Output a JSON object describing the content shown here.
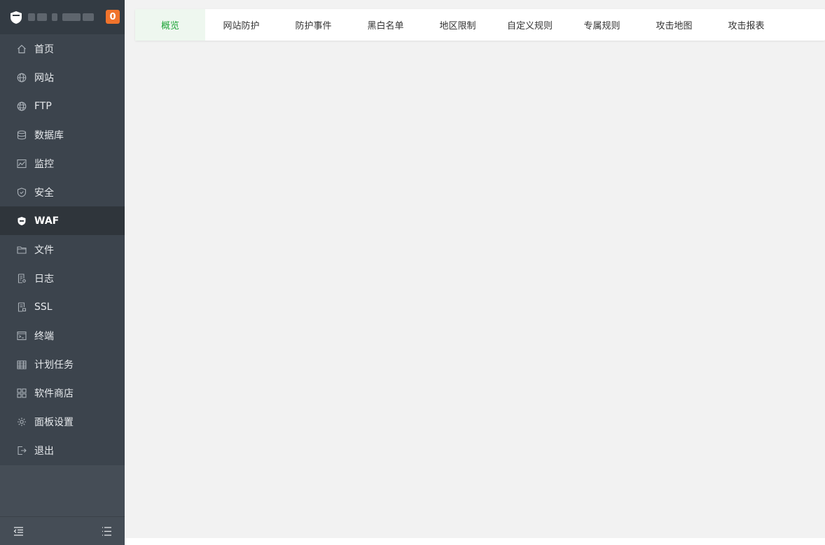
{
  "brand": {
    "badge_count": "0",
    "logo_icon": "shield-logo-icon"
  },
  "sidebar": {
    "items": [
      {
        "label": "首页",
        "icon": "home-icon"
      },
      {
        "label": "网站",
        "icon": "globe-icon"
      },
      {
        "label": "FTP",
        "icon": "ftp-globe-icon"
      },
      {
        "label": "数据库",
        "icon": "database-icon"
      },
      {
        "label": "监控",
        "icon": "monitor-icon"
      },
      {
        "label": "安全",
        "icon": "shield-icon"
      },
      {
        "label": "WAF",
        "icon": "waf-shield-icon",
        "active": true
      },
      {
        "label": "文件",
        "icon": "folder-icon"
      },
      {
        "label": "日志",
        "icon": "log-icon"
      },
      {
        "label": "SSL",
        "icon": "certificate-icon"
      },
      {
        "label": "终端",
        "icon": "terminal-icon"
      },
      {
        "label": "计划任务",
        "icon": "calendar-icon"
      },
      {
        "label": "软件商店",
        "icon": "grid-icon"
      },
      {
        "label": "面板设置",
        "icon": "gear-icon"
      },
      {
        "label": "退出",
        "icon": "logout-icon"
      }
    ],
    "footer": {
      "left_icon": "collapse-menu-icon",
      "right_icon": "list-menu-icon"
    }
  },
  "tabs": [
    {
      "label": "概览",
      "active": true
    },
    {
      "label": "网站防护"
    },
    {
      "label": "防护事件"
    },
    {
      "label": "黑白名单"
    },
    {
      "label": "地区限制"
    },
    {
      "label": "自定义规则"
    },
    {
      "label": "专属规则"
    },
    {
      "label": "攻击地图"
    },
    {
      "label": "攻击报表"
    }
  ],
  "colors": {
    "accent": "#20a53a",
    "sidebar_bg": "#3c444d",
    "badge": "#f0732c"
  }
}
